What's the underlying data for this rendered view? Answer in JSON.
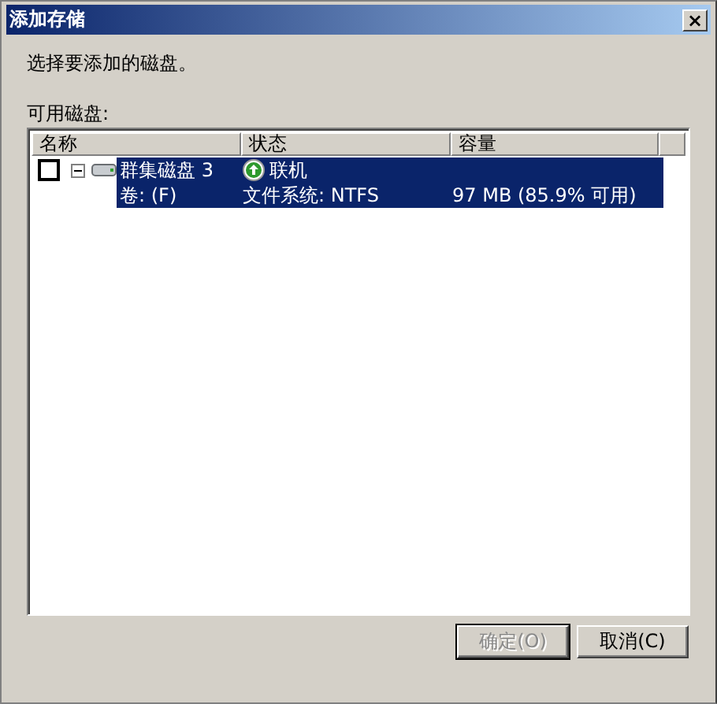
{
  "window": {
    "title": "添加存储",
    "close": "×"
  },
  "instruction": "选择要添加的磁盘。",
  "list_label": "可用磁盘:",
  "columns": [
    "名称",
    "状态",
    "容量"
  ],
  "disks": [
    {
      "name": "群集磁盘 3",
      "volume": "卷: (F)",
      "status": "联机",
      "filesystem": "文件系统: NTFS",
      "capacity": "97 MB (85.9% 可用)",
      "checked": false,
      "expanded": true,
      "selected": true
    }
  ],
  "buttons": [
    {
      "label": "确定(O)",
      "disabled": true
    },
    {
      "label": "取消(C)",
      "disabled": false
    }
  ]
}
